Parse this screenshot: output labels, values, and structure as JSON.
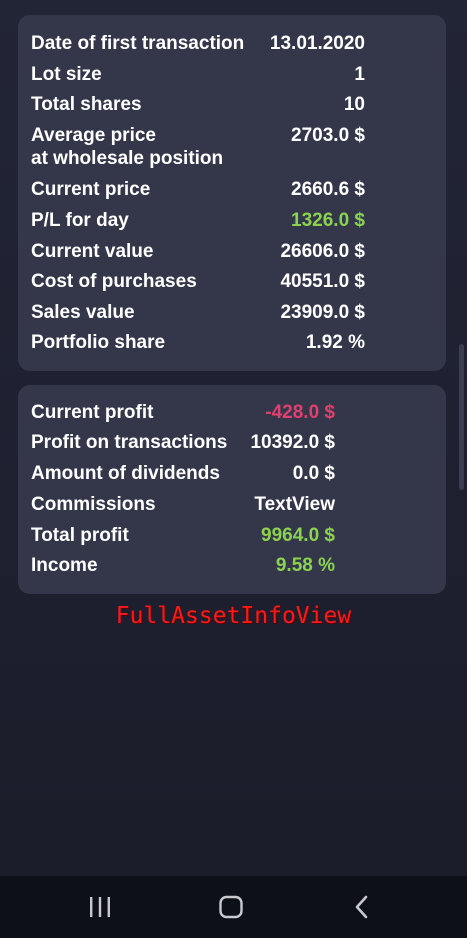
{
  "summary_card": {
    "rows": [
      {
        "label": "Date of first transaction",
        "value": "13.01.2020"
      },
      {
        "label": "Lot size",
        "value": "1"
      },
      {
        "label": "Total shares",
        "value": "10"
      },
      {
        "label": "Average price",
        "label2": "at wholesale position",
        "value": "2703.0 $"
      },
      {
        "label": "Current price",
        "value": "2660.6 $"
      },
      {
        "label": "P/L for day",
        "value": "1326.0 $"
      },
      {
        "label": "Current value",
        "value": "26606.0 $"
      },
      {
        "label": "Cost of purchases",
        "value": "40551.0 $"
      },
      {
        "label": "Sales value",
        "value": "23909.0 $"
      },
      {
        "label": "Portfolio share",
        "value": "1.92 %"
      }
    ]
  },
  "profit_card": {
    "rows": [
      {
        "label": "Current profit",
        "value": "-428.0 $"
      },
      {
        "label": "Profit on transactions",
        "value": "10392.0 $"
      },
      {
        "label": "Amount of dividends",
        "value": "0.0 $"
      },
      {
        "label": "Commissions",
        "value": "TextView"
      },
      {
        "label": "Total profit",
        "value": "9964.0 $"
      },
      {
        "label": "Income",
        "value": "9.58 %"
      }
    ]
  },
  "debug_label": "FullAssetInfoView",
  "colors": {
    "positive": "#8bd34f",
    "negative": "#e0406f",
    "card": "#34374a"
  },
  "navbar": {
    "icons": [
      "recent-apps-icon",
      "home-icon",
      "back-icon"
    ]
  }
}
